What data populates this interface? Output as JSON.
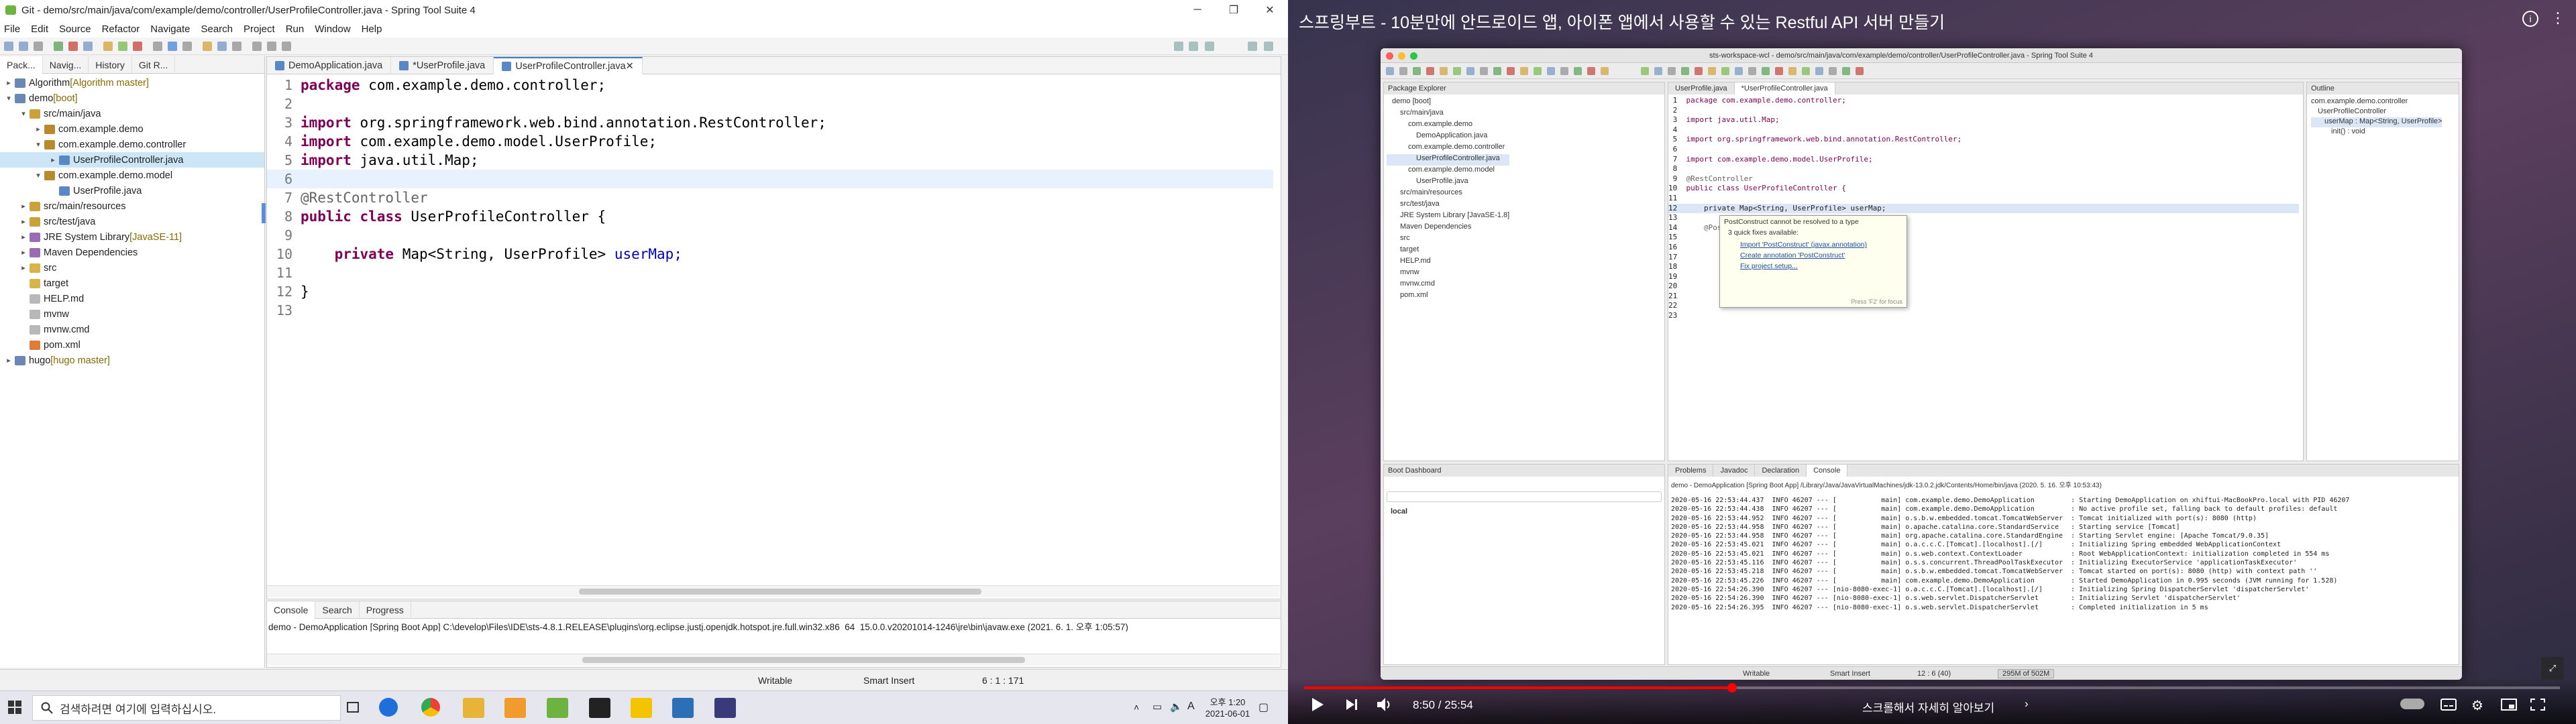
{
  "left": {
    "window_title": "Git - demo/src/main/java/com/example/demo/controller/UserProfileController.java - Spring Tool Suite 4",
    "menu": [
      "File",
      "Edit",
      "Source",
      "Refactor",
      "Navigate",
      "Search",
      "Project",
      "Run",
      "Window",
      "Help"
    ],
    "explorer_tabs": [
      "Pack...",
      "Navig...",
      "History",
      "Git R..."
    ],
    "tree": [
      {
        "arrow": "▸",
        "label": "Algorithm",
        "deco": " [Algorithm master]",
        "indent": 0,
        "icon": "project-icon"
      },
      {
        "arrow": "▾",
        "label": "demo",
        "deco": " [boot]",
        "indent": 0,
        "icon": "project-icon"
      },
      {
        "arrow": "▾",
        "label": "src/main/java",
        "deco": "",
        "indent": 1,
        "icon": "source-folder-icon"
      },
      {
        "arrow": "▸",
        "label": "com.example.demo",
        "deco": "",
        "indent": 2,
        "icon": "package-icon"
      },
      {
        "arrow": "▾",
        "label": "com.example.demo.controller",
        "deco": "",
        "indent": 2,
        "icon": "package-icon"
      },
      {
        "arrow": "▸",
        "label": "UserProfileController.java",
        "deco": "",
        "indent": 3,
        "icon": "java-file-icon",
        "selected": true
      },
      {
        "arrow": "▾",
        "label": "com.example.demo.model",
        "deco": "",
        "indent": 2,
        "icon": "package-icon"
      },
      {
        "arrow": "",
        "label": "UserProfile.java",
        "deco": "",
        "indent": 3,
        "icon": "java-file-icon"
      },
      {
        "arrow": "▸",
        "label": "src/main/resources",
        "deco": "",
        "indent": 1,
        "icon": "source-folder-icon"
      },
      {
        "arrow": "▸",
        "label": "src/test/java",
        "deco": "",
        "indent": 1,
        "icon": "source-folder-icon"
      },
      {
        "arrow": "▸",
        "label": "JRE System Library",
        "deco": " [JavaSE-11]",
        "indent": 1,
        "icon": "library-icon"
      },
      {
        "arrow": "▸",
        "label": "Maven Dependencies",
        "deco": "",
        "indent": 1,
        "icon": "library-icon"
      },
      {
        "arrow": "▸",
        "label": "src",
        "deco": "",
        "indent": 1,
        "icon": "folder-icon"
      },
      {
        "arrow": "",
        "label": "target",
        "deco": "",
        "indent": 1,
        "icon": "folder-icon"
      },
      {
        "arrow": "",
        "label": "HELP.md",
        "deco": "",
        "indent": 1,
        "icon": "file-icon"
      },
      {
        "arrow": "",
        "label": "mvnw",
        "deco": "",
        "indent": 1,
        "icon": "file-icon"
      },
      {
        "arrow": "",
        "label": "mvnw.cmd",
        "deco": "",
        "indent": 1,
        "icon": "file-icon"
      },
      {
        "arrow": "",
        "label": "pom.xml",
        "deco": "",
        "indent": 1,
        "icon": "xml-file-icon"
      },
      {
        "arrow": "▸",
        "label": "hugo",
        "deco": " [hugo master]",
        "indent": 0,
        "icon": "project-icon"
      }
    ],
    "editor_tabs": [
      {
        "label": "DemoApplication.java",
        "active": false
      },
      {
        "label": "*UserProfile.java",
        "active": false
      },
      {
        "label": "UserProfileController.java",
        "active": true
      }
    ],
    "code": [
      {
        "n": "1",
        "parts": [
          [
            "kw",
            "package"
          ],
          [
            "",
            "com.example.demo.controller;"
          ]
        ]
      },
      {
        "n": "2",
        "parts": []
      },
      {
        "n": "3",
        "parts": [
          [
            "kw",
            "import"
          ],
          [
            "",
            "org.springframework.web.bind.annotation.RestController;"
          ]
        ]
      },
      {
        "n": "4",
        "parts": [
          [
            "kw",
            "import"
          ],
          [
            "",
            "com.example.demo.model.UserProfile;"
          ]
        ]
      },
      {
        "n": "5",
        "parts": [
          [
            "kw",
            "import"
          ],
          [
            "",
            "java.util.Map;"
          ]
        ]
      },
      {
        "n": "6",
        "parts": [],
        "cur": true
      },
      {
        "n": "7",
        "parts": [
          [
            "ann",
            "@RestController"
          ]
        ]
      },
      {
        "n": "8",
        "parts": [
          [
            "kw",
            "public"
          ],
          [
            "kw",
            "class"
          ],
          [
            "",
            "UserProfileController {"
          ]
        ]
      },
      {
        "n": "9",
        "parts": []
      },
      {
        "n": "10",
        "parts": [
          [
            "",
            "    "
          ],
          [
            "kw",
            "private"
          ],
          [
            "",
            "Map<String, UserProfile>"
          ],
          [
            "fld",
            "userMap;"
          ]
        ]
      },
      {
        "n": "11",
        "parts": []
      },
      {
        "n": "12",
        "parts": [
          [
            "",
            "}"
          ]
        ]
      },
      {
        "n": "13",
        "parts": []
      }
    ],
    "console_tabs": [
      "Console",
      "Search",
      "Progress"
    ],
    "console_text": "demo - DemoApplication [Spring Boot App] C:\\develop\\Files\\IDE\\sts-4.8.1.RELEASE\\plugins\\org.eclipse.justj.openjdk.hotspot.jre.full.win32.x86_64_15.0.0.v20201014-1246\\jre\\bin\\javaw.exe  (2021. 6. 1. 오후 1:05:57)",
    "status": {
      "writable": "Writable",
      "insert": "Smart Insert",
      "position": "6 : 1 : 171"
    },
    "taskbar": {
      "search_placeholder": "검색하려면 여기에 입력하십시오.",
      "time": "오후 1:20",
      "date": "2021-06-01",
      "ime": "A"
    }
  },
  "right": {
    "video_title": "스프링부트 - 10분만에 안드로이드 앱, 아이폰 앱에서 사용할 수 있는 Restful API 서버 만들기",
    "mac_title": "sts-workspace-wcl - demo/src/main/java/com/example/demo/controller/UserProfileController.java - Spring Tool Suite 4",
    "mac_tabs": [
      "UserProfile.java",
      "*UserProfileController.java"
    ],
    "mac_explorer_title": "Package Explorer",
    "mac_tree": [
      "demo [boot]",
      "src/main/java",
      "com.example.demo",
      "DemoApplication.java",
      "com.example.demo.controller",
      "UserProfileController.java",
      "com.example.demo.model",
      "UserProfile.java",
      "src/main/resources",
      "src/test/java",
      "JRE System Library [JavaSE-1.8]",
      "Maven Dependencies",
      "src",
      "target",
      "HELP.md",
      "mvnw",
      "mvnw.cmd",
      "pom.xml"
    ],
    "mac_code": [
      "package com.example.demo.controller;",
      "",
      "import java.util.Map;",
      "",
      "import org.springframework.web.bind.annotation.RestController;",
      "",
      "import com.example.demo.model.UserProfile;",
      "",
      "@RestController",
      "public class UserProfileController {",
      "",
      "    private Map<String, UserProfile> userMap;",
      "",
      "    @PostConstruct",
      "",
      "",
      "",
      "",
      "",
      "",
      "",
      "",
      ""
    ],
    "quickfix": {
      "header": "PostConstruct cannot be resolved to a type",
      "sub": "3 quick fixes available:",
      "items": [
        "Import 'PostConstruct' (javax.annotation)",
        "Create annotation 'PostConstruct'",
        "Fix project setup..."
      ],
      "footer": "Press 'F2' for focus"
    },
    "outline_title": "Outline",
    "outline": [
      "com.example.demo.controller",
      "UserProfileController",
      "userMap : Map<String, UserProfile>",
      "init() : void"
    ],
    "boot_dashboard": "Boot Dashboard",
    "boot_local": "local",
    "console_tabs": [
      "Problems",
      "Javadoc",
      "Declaration",
      "Console"
    ],
    "console_header": "demo - DemoApplication [Spring Boot App] /Library/Java/JavaVirtualMachines/jdk-13.0.2.jdk/Contents/Home/bin/java (2020. 5. 16. 오후 10:53:43)",
    "console_lines": [
      "2020-05-16 22:53:44.437  INFO 46207 --- [           main] com.example.demo.DemoApplication         : Starting DemoApplication on xhiftui-MacBookPro.local with PID 46207",
      "2020-05-16 22:53:44.438  INFO 46207 --- [           main] com.example.demo.DemoApplication         : No active profile set, falling back to default profiles: default",
      "2020-05-16 22:53:44.952  INFO 46207 --- [           main] o.s.b.w.embedded.tomcat.TomcatWebServer  : Tomcat initialized with port(s): 8080 (http)",
      "2020-05-16 22:53:44.958  INFO 46207 --- [           main] o.apache.catalina.core.StandardService   : Starting service [Tomcat]",
      "2020-05-16 22:53:44.958  INFO 46207 --- [           main] org.apache.catalina.core.StandardEngine  : Starting Servlet engine: [Apache Tomcat/9.0.35]",
      "2020-05-16 22:53:45.021  INFO 46207 --- [           main] o.a.c.c.C.[Tomcat].[localhost].[/]       : Initializing Spring embedded WebApplicationContext",
      "2020-05-16 22:53:45.021  INFO 46207 --- [           main] o.s.web.context.ContextLoader            : Root WebApplicationContext: initialization completed in 554 ms",
      "2020-05-16 22:53:45.116  INFO 46207 --- [           main] o.s.s.concurrent.ThreadPoolTaskExecutor  : Initializing ExecutorService 'applicationTaskExecutor'",
      "2020-05-16 22:53:45.218  INFO 46207 --- [           main] o.s.b.w.embedded.tomcat.TomcatWebServer  : Tomcat started on port(s): 8080 (http) with context path ''",
      "2020-05-16 22:53:45.226  INFO 46207 --- [           main] com.example.demo.DemoApplication         : Started DemoApplication in 0.995 seconds (JVM running for 1.528)",
      "2020-05-16 22:54:26.390  INFO 46207 --- [nio-8080-exec-1] o.a.c.c.C.[Tomcat].[localhost].[/]       : Initializing Spring DispatcherServlet 'dispatcherServlet'",
      "2020-05-16 22:54:26.390  INFO 46207 --- [nio-8080-exec-1] o.s.web.servlet.DispatcherServlet        : Initializing Servlet 'dispatcherServlet'",
      "2020-05-16 22:54:26.395  INFO 46207 --- [nio-8080-exec-1] o.s.web.servlet.DispatcherServlet        : Completed initialization in 5 ms"
    ],
    "mac_status": {
      "writable": "Writable",
      "insert": "Smart Insert",
      "position": "12 : 6 (40)",
      "memory": "295M of 502M"
    },
    "player": {
      "time": "8:50 / 25:54",
      "chapter": "스크롤해서 자세히 알아보기",
      "progress": 0.341
    }
  }
}
